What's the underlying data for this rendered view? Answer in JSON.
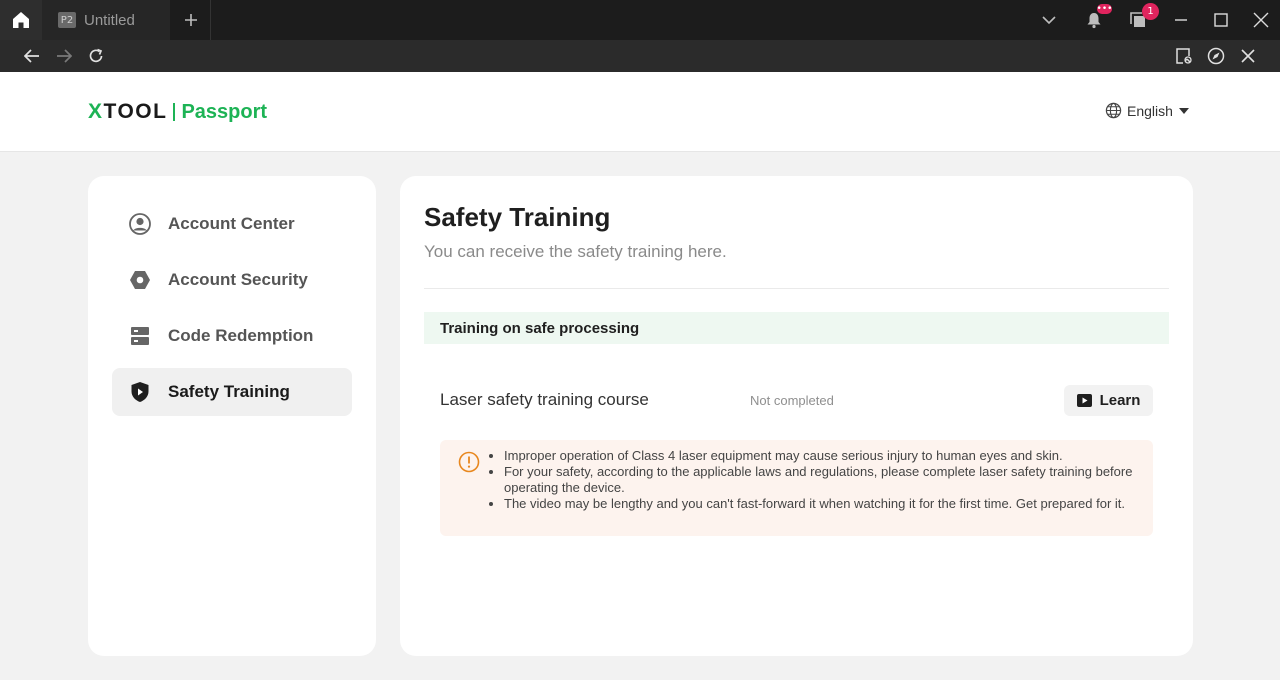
{
  "browser": {
    "tab_favicon": "P2",
    "tab_title": "Untitled",
    "notifications_badge": "•••",
    "windows_badge": "1",
    "icons": [
      "home-icon",
      "plus-icon",
      "chevron-down-icon",
      "bell-icon",
      "windows-icon",
      "minimize-icon",
      "maximize-icon",
      "close-icon",
      "back-icon",
      "forward-icon",
      "reload-icon",
      "screenshot-icon",
      "compass-icon",
      "close-icon"
    ]
  },
  "header": {
    "logo_brand": "XTOOL",
    "logo_product": "Passport",
    "language": "English"
  },
  "sidebar": {
    "items": [
      {
        "label": "Account Center",
        "icon": "user-circle-icon",
        "active": false
      },
      {
        "label": "Account Security",
        "icon": "hexagon-icon",
        "active": false
      },
      {
        "label": "Code Redemption",
        "icon": "server-icon",
        "active": false
      },
      {
        "label": "Safety Training",
        "icon": "shield-play-icon",
        "active": true
      }
    ]
  },
  "main": {
    "title": "Safety Training",
    "subtitle": "You can receive the safety training here.",
    "section_title": "Training on safe processing",
    "course": {
      "name": "Laser safety training course",
      "status": "Not completed",
      "button_label": "Learn"
    },
    "warnings": [
      "Improper operation of Class 4 laser equipment may cause serious injury to human eyes and skin.",
      "For your safety, according to the applicable laws and regulations, please complete laser safety training before operating the device.",
      "The video may be lengthy and you can't fast-forward it when watching it for the first time. Get prepared for it."
    ]
  },
  "colors": {
    "brand_green": "#1db355",
    "section_bg": "#eef8f1",
    "warning_bg": "#fdf3ee",
    "warning_accent": "#e8871e",
    "badge_red": "#e0245e"
  }
}
